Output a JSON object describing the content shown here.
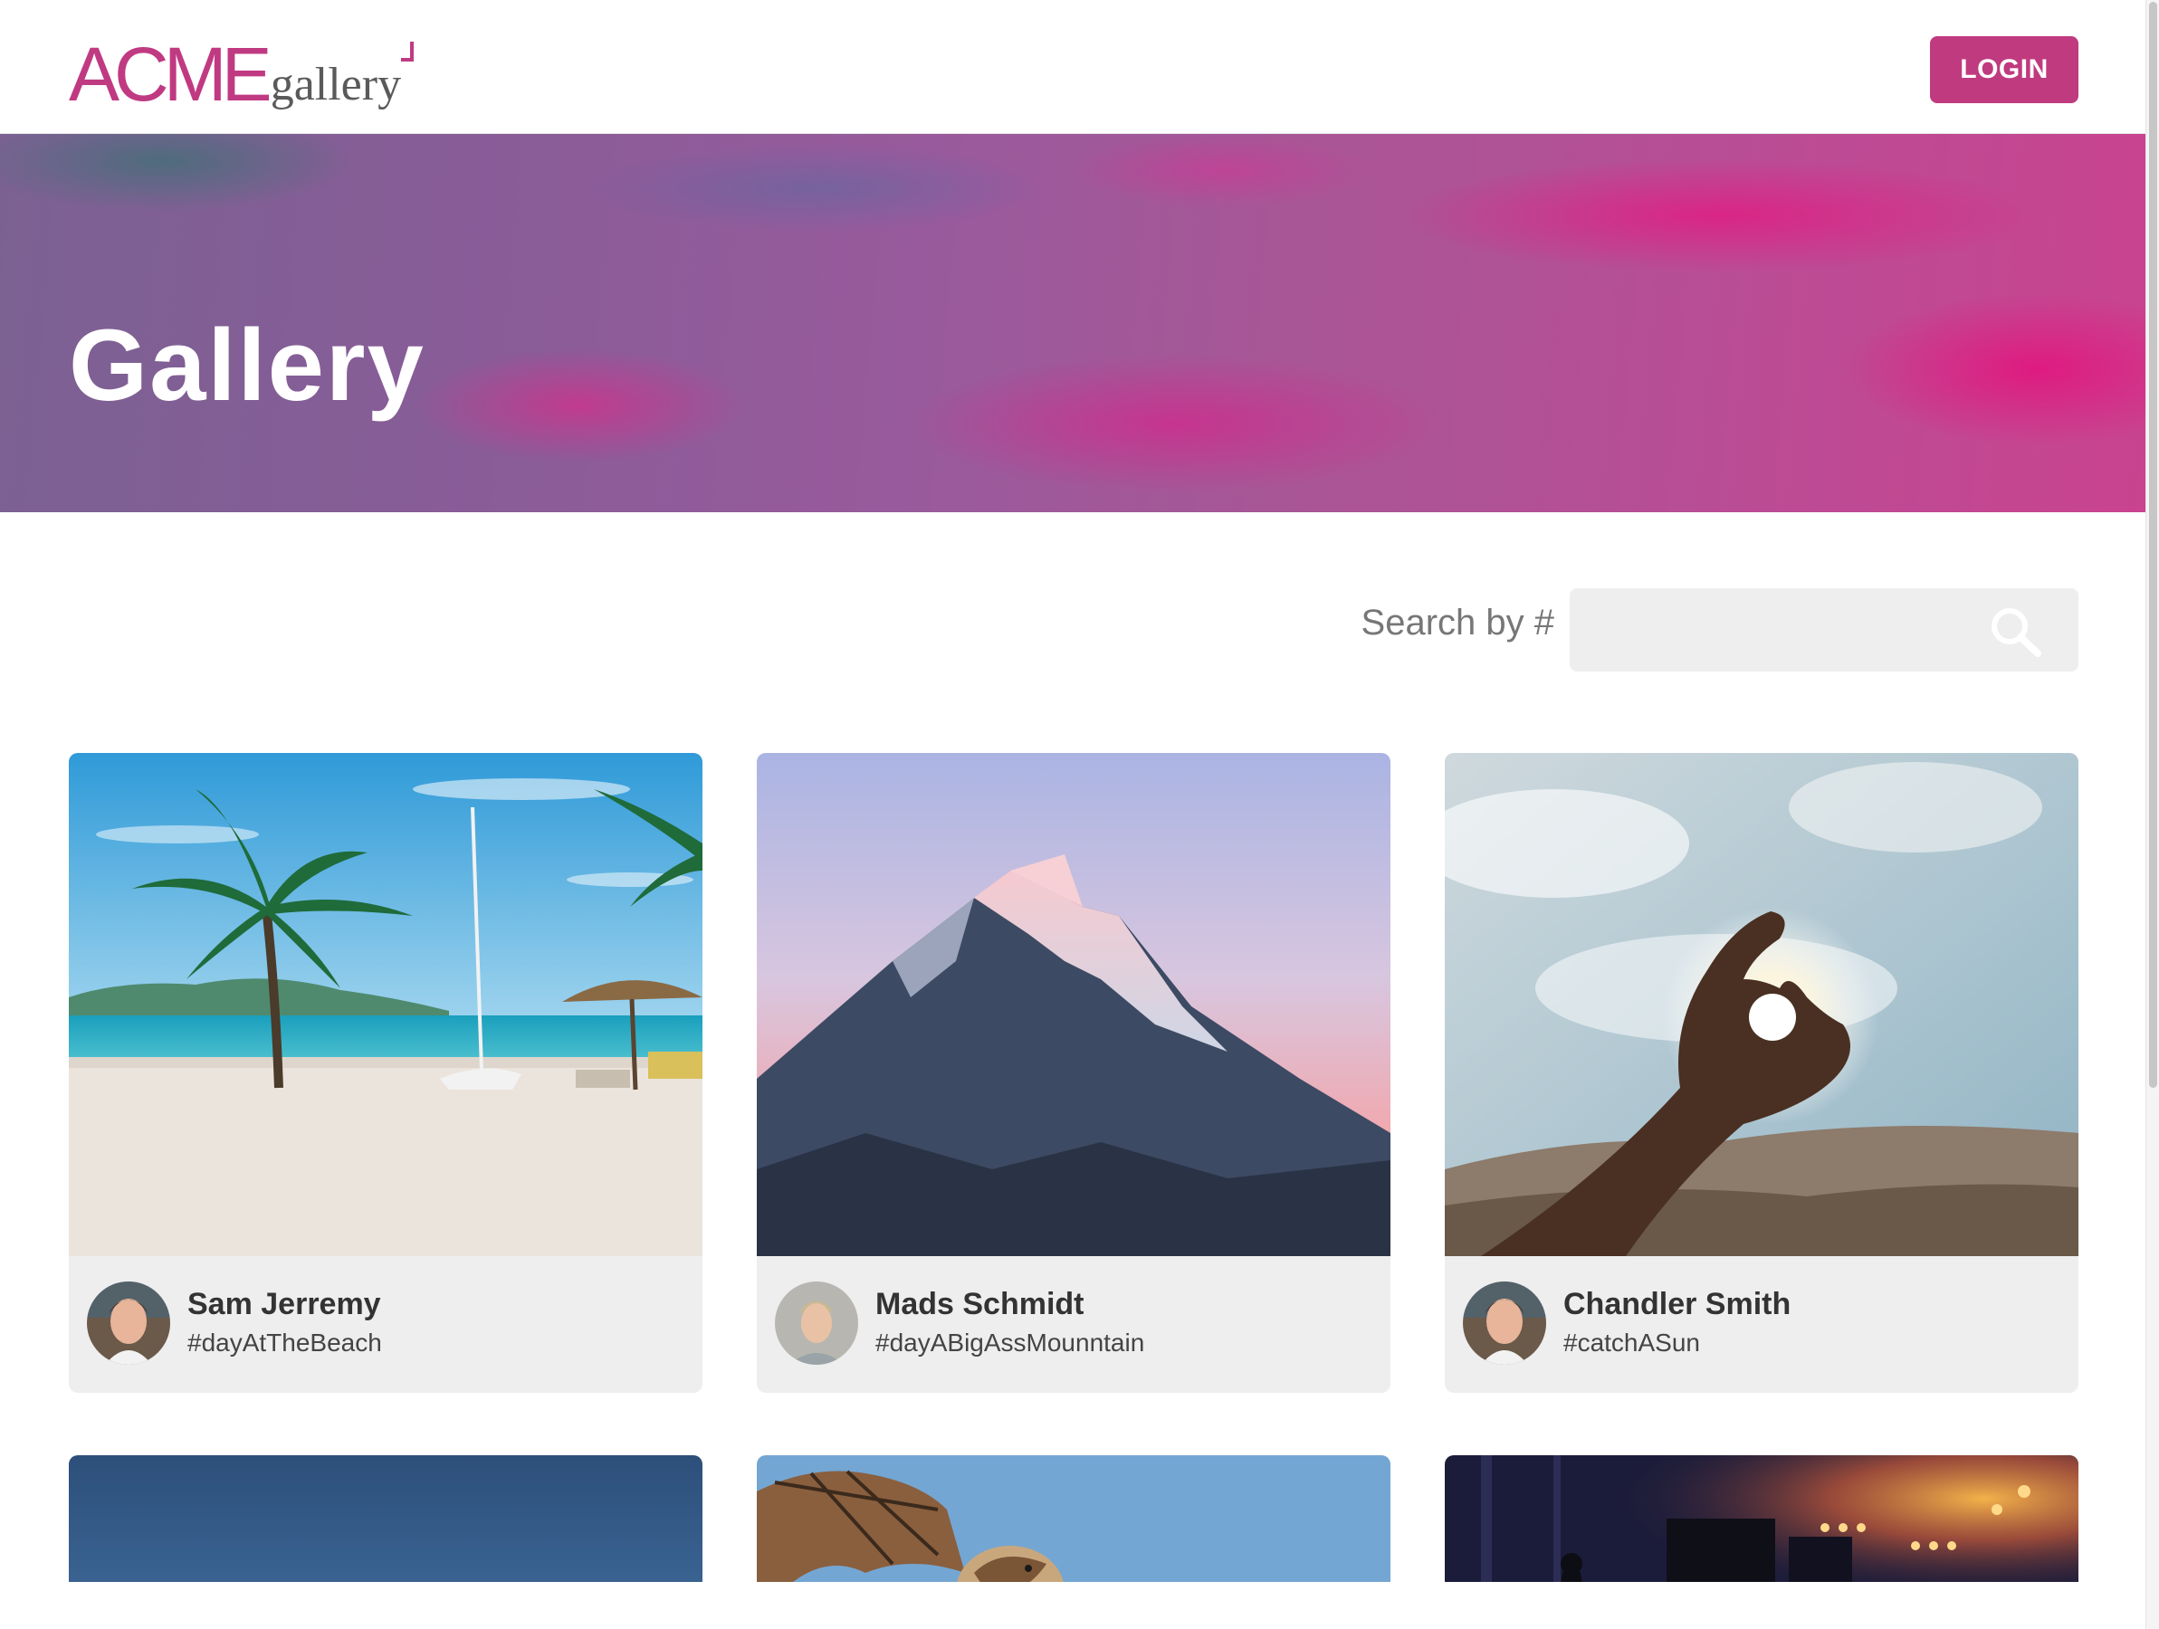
{
  "header": {
    "logo_primary": "ACME",
    "logo_secondary": "gallery",
    "login_label": "LOGIN"
  },
  "hero": {
    "title": "Gallery"
  },
  "search": {
    "label": "Search by #",
    "placeholder": "",
    "value": ""
  },
  "colors": {
    "brand": "#c03a7f",
    "hero_pink": "#e01e82",
    "card_bg": "#eeeeee"
  },
  "cards": [
    {
      "author": "Sam Jerremy",
      "tag": "#dayAtTheBeach",
      "image": "beach-photo",
      "avatar": "man-avatar"
    },
    {
      "author": "Mads Schmidt",
      "tag": "#dayABigAssMounntain",
      "image": "mountain-photo",
      "avatar": "blonde-man-avatar"
    },
    {
      "author": "Chandler Smith",
      "tag": "#catchASun",
      "image": "hand-sun-photo",
      "avatar": "man-avatar"
    },
    {
      "image": "blue-sky-photo"
    },
    {
      "image": "bat-photo"
    },
    {
      "image": "concert-photo"
    }
  ]
}
